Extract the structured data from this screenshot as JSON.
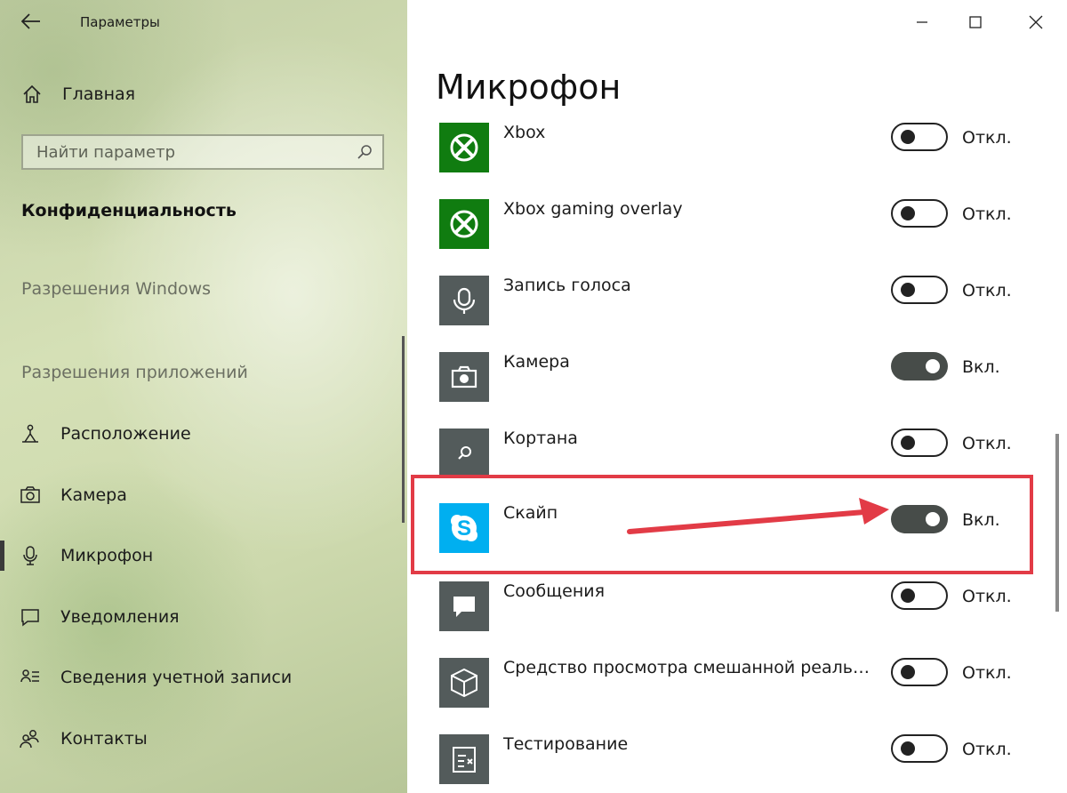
{
  "window": {
    "title": "Параметры",
    "back_icon": "arrow-left-icon",
    "controls": [
      "minimize-icon",
      "maximize-icon",
      "close-icon"
    ]
  },
  "sidebar": {
    "home_label": "Главная",
    "search_placeholder": "Найти параметр",
    "section_title": "Конфиденциальность",
    "group_windows": "Разрешения Windows",
    "group_apps": "Разрешения приложений",
    "items": [
      {
        "label": "Расположение",
        "icon": "location-icon"
      },
      {
        "label": "Камера",
        "icon": "camera-icon"
      },
      {
        "label": "Микрофон",
        "icon": "microphone-icon",
        "selected": true
      },
      {
        "label": "Уведомления",
        "icon": "notification-icon"
      },
      {
        "label": "Сведения учетной записи",
        "icon": "account-info-icon"
      },
      {
        "label": "Контакты",
        "icon": "contacts-icon"
      }
    ]
  },
  "main": {
    "page_title": "Микрофон",
    "apps": [
      {
        "name": "Xbox",
        "icon": "xbox-icon",
        "on": false,
        "state": "Откл."
      },
      {
        "name": "Xbox gaming overlay",
        "icon": "xbox-icon",
        "on": false,
        "state": "Откл."
      },
      {
        "name": "Запись голоса",
        "icon": "voice-recorder-icon",
        "on": false,
        "state": "Откл."
      },
      {
        "name": "Камера",
        "icon": "camera-app-icon",
        "on": true,
        "state": "Вкл."
      },
      {
        "name": "Кортана",
        "icon": "cortana-icon",
        "on": false,
        "state": "Откл."
      },
      {
        "name": "Скайп",
        "icon": "skype-icon",
        "on": true,
        "state": "Вкл.",
        "highlighted": true
      },
      {
        "name": "Сообщения",
        "icon": "messaging-icon",
        "on": false,
        "state": "Откл."
      },
      {
        "name": "Средство просмотра смешанной реальн...",
        "icon": "mixed-reality-icon",
        "on": false,
        "state": "Откл."
      },
      {
        "name": "Тестирование",
        "icon": "testing-icon",
        "on": false,
        "state": "Откл."
      }
    ]
  },
  "colors": {
    "xbox_green": "#107c10",
    "tile_gray": "#535b5b",
    "skype_blue": "#00aff0",
    "toggle_on": "#474c49",
    "highlight_red": "#e23b46"
  }
}
